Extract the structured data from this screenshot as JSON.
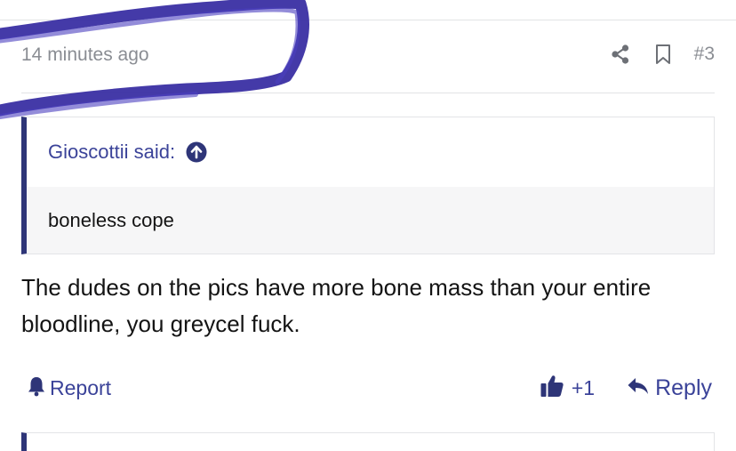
{
  "post": {
    "timestamp": "14 minutes ago",
    "post_number": "#3",
    "actions": {
      "share_icon": "share-icon",
      "bookmark_icon": "bookmark-icon"
    }
  },
  "quote": {
    "author_label": "Gioscottii said:",
    "arrow_icon": "arrow-up-circle-icon",
    "body": "boneless cope"
  },
  "message": {
    "text": "The dudes on the pics have more bone mass than your entire bloodline, you greycel fuck."
  },
  "footer": {
    "report_label": "Report",
    "report_icon": "bell-icon",
    "like_count": "+1",
    "like_icon": "thumbs-up-icon",
    "reply_label": "Reply",
    "reply_icon": "reply-arrow-icon"
  },
  "colors": {
    "accent": "#3b4399",
    "quote_bar": "#2e3578",
    "muted_text": "#8a8d93",
    "scribble": "#3a2fa3",
    "quote_body_bg": "#f6f6f7"
  }
}
